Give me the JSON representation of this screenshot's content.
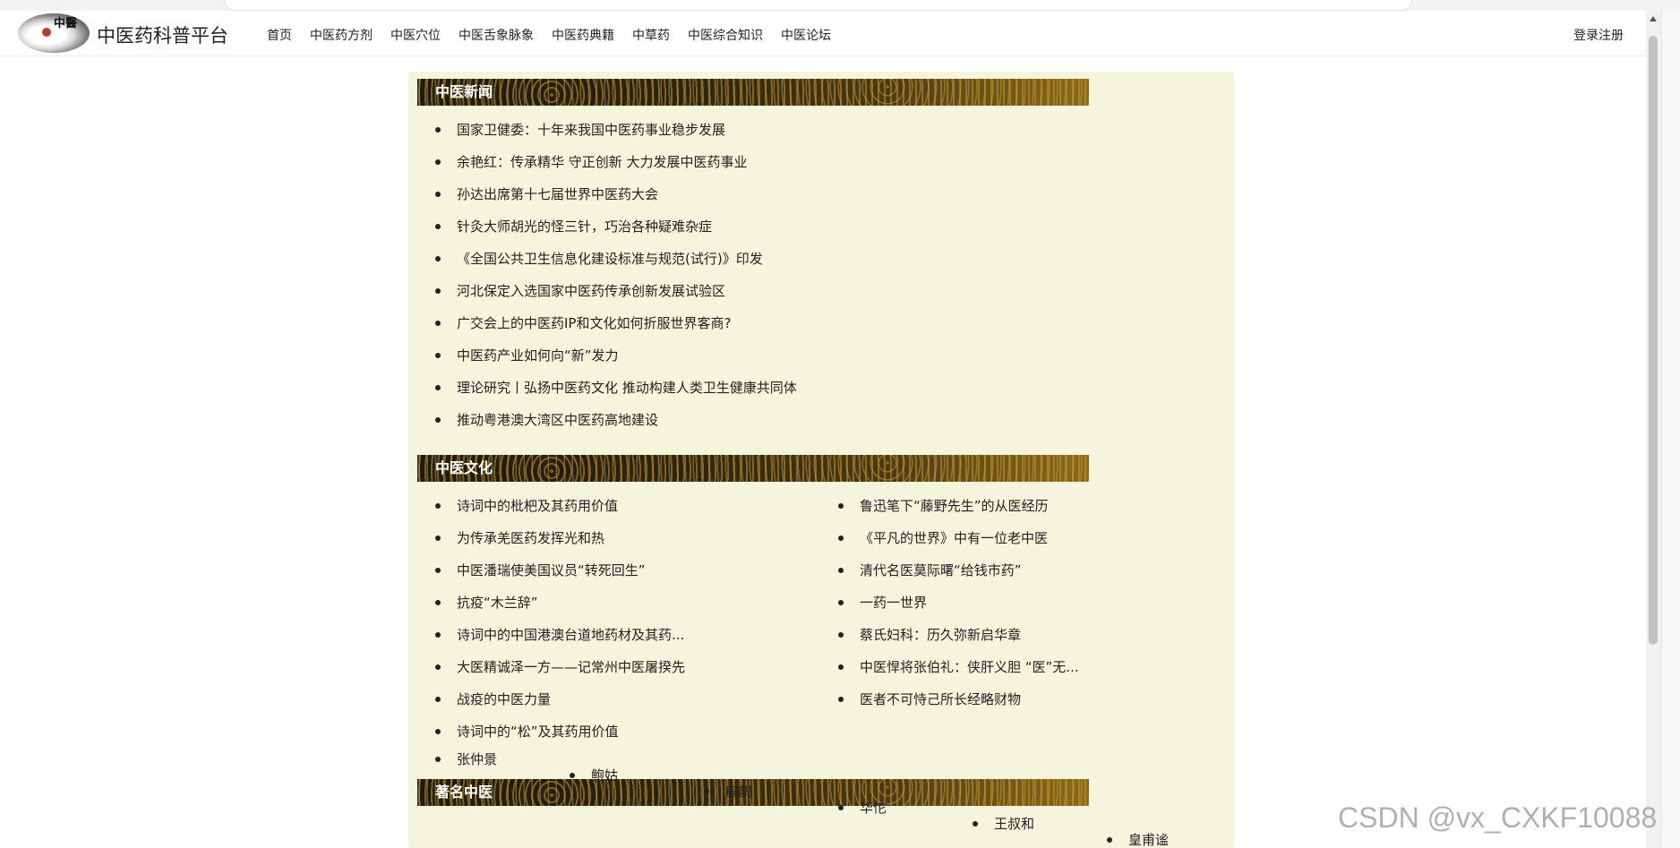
{
  "site": {
    "name": "中医药科普平台",
    "logo_text": "中醫"
  },
  "nav": {
    "items": [
      "首页",
      "中医药方剂",
      "中医穴位",
      "中医舌象脉象",
      "中医药典籍",
      "中草药",
      "中医综合知识",
      "中医论坛"
    ],
    "login": "登录注册"
  },
  "sections": {
    "news": {
      "title": "中医新闻",
      "items": [
        "国家卫健委：十年来我国中医药事业稳步发展",
        "余艳红：传承精华 守正创新 大力发展中医药事业",
        "孙达出席第十七届世界中医药大会",
        "针灸大师胡光的怪三针，巧治各种疑难杂症",
        "《全国公共卫生信息化建设标准与规范(试行)》印发",
        "河北保定入选国家中医药传承创新发展试验区",
        "广交会上的中医药IP和文化如何折服世界客商?",
        "中医药产业如何向“新”发力",
        "理论研究丨弘扬中医药文化 推动构建人类卫生健康共同体",
        "推动粤港澳大湾区中医药高地建设"
      ]
    },
    "culture": {
      "title": "中医文化",
      "left": [
        "诗词中的枇杷及其药用价值",
        "为传承羌医药发挥光和热",
        "中医潘瑞使美国议员“转死回生”",
        "抗疫“木兰辞”",
        "诗词中的中国港澳台道地药材及其药...",
        "大医精诚泽一方——记常州中医屠揆先",
        "战疫的中医力量",
        "诗词中的“松”及其药用价值"
      ],
      "right": [
        "鲁迅笔下“藤野先生”的从医经历",
        "《平凡的世界》中有一位老中医",
        "清代名医莫际曙“给钱市药”",
        "一药一世界",
        "蔡氏妇科：历久弥新启华章",
        "中医悍将张伯礼：侠肝义胆 “医”无...",
        "医者不可恃己所长经略财物"
      ]
    },
    "famous": {
      "title": "著名中医",
      "items": [
        "张仲景",
        "鲍姑",
        "扁鹊",
        "华佗",
        "王叔和",
        "皇甫谧"
      ]
    }
  },
  "watermark": "CSDN @vx_CXKF10088"
}
